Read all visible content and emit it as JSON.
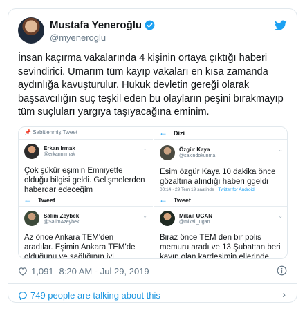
{
  "author": {
    "name": "Mustafa Yeneroğlu",
    "handle": "@myeneroglu"
  },
  "tweet_lines": [
    "İnsan kaçırma vakalarında 4 kişinin ortaya çıktığı haberi",
    "sevindirici.  Umarım tüm kayıp vakaları en kısa zamanda",
    "aydınlığa kavuşturulur. Hukuk devletin gereği olarak",
    "başsavcılığın  suç teşkil eden bu olayların peşini bırakmayıp",
    "tüm suçluları yargıya taşıyacağına eminim."
  ],
  "media": {
    "q1": {
      "top": "Sabitlenmiş Tweet",
      "name": "Erkan Irmak",
      "handle": "@erkannirmak",
      "lines": [
        "Çok şükür eşimin Emniyette",
        "olduğu bilgisi geldi. Gelişmelerden",
        "haberdar edeceğim"
      ]
    },
    "q2": {
      "top": "Dizi",
      "name": "Özgür Kaya",
      "handle": "@sakindokunma",
      "lines": [
        "Esim özgür Kaya 10 dakika önce",
        "gözaltına alındığı haberi ggeldi"
      ],
      "meta": "00:14 · 29 Tem 19 saatinde · ",
      "meta_link": "Twitter for Android"
    },
    "q3": {
      "top": "Tweet",
      "name": "Salim Zeybek",
      "handle": "@SalimAzeybek",
      "lines": [
        "Az önce Ankara TEM'den",
        "aradılar. Eşimin Ankara TEM'de",
        "olduğunu ve sağlığının iyi"
      ]
    },
    "q4": {
      "top": "Tweet",
      "name": "Mikail UGAN",
      "handle": "@mikail_ugan",
      "lines": [
        "Biraz önce TEM den bir polis",
        "memuru aradı ve 13 Şubattan beri",
        "kayıp olan  kardesimin ellerinde"
      ]
    }
  },
  "stats": {
    "likes": "1,091",
    "timestamp": "8:20 AM - Jul 29, 2019"
  },
  "footer": {
    "label": "749 people are talking about this"
  },
  "colors": {
    "brand_blue": "#1da1f2",
    "text": "#14171a",
    "muted": "#657786"
  }
}
